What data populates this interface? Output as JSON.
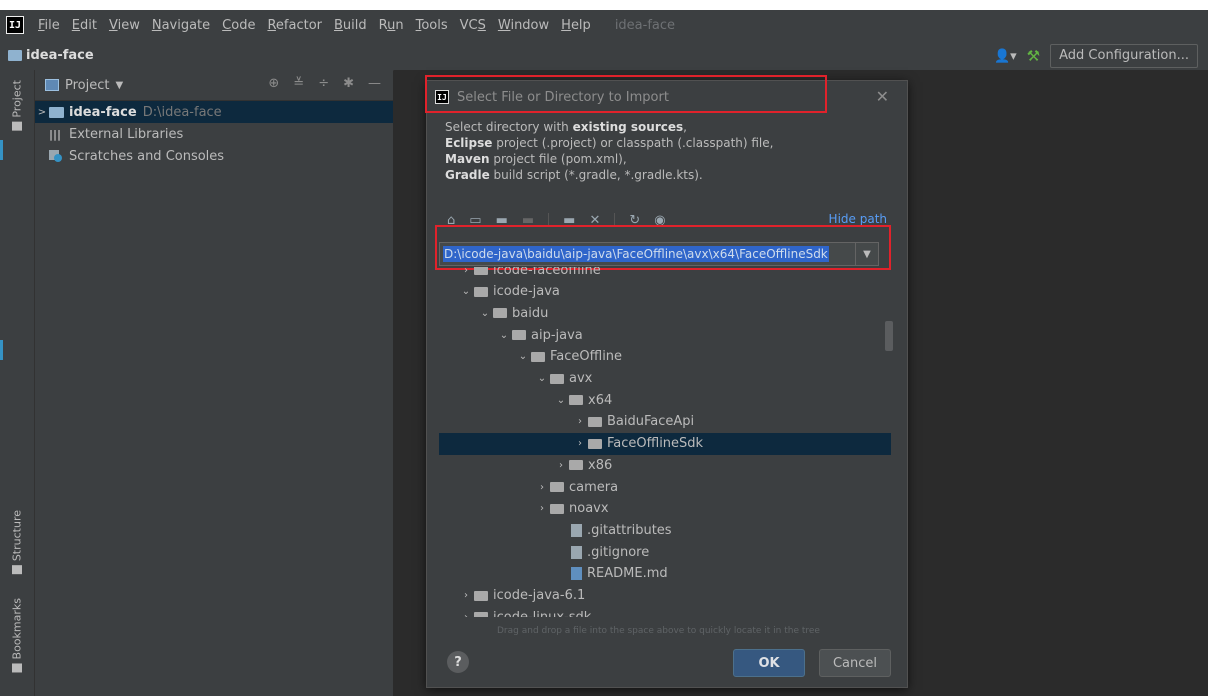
{
  "window": {
    "project_name": "idea-face"
  },
  "menu": [
    "File",
    "Edit",
    "View",
    "Navigate",
    "Code",
    "Refactor",
    "Build",
    "Run",
    "Tools",
    "VCS",
    "Window",
    "Help"
  ],
  "menu_mnemonic": [
    "F",
    "E",
    "V",
    "N",
    "C",
    "R",
    "B",
    "u",
    "T",
    "S",
    "W",
    "H"
  ],
  "navbar": {
    "title": "idea-face",
    "add_config": "Add Configuration..."
  },
  "side_tabs": {
    "project": "Project",
    "structure": "Structure",
    "bookmarks": "Bookmarks"
  },
  "project_panel": {
    "title": "Project",
    "tree": [
      {
        "label": "idea-face",
        "path": "D:\\idea-face",
        "selected": true
      },
      {
        "label": "External Libraries"
      },
      {
        "label": "Scratches and Consoles"
      }
    ]
  },
  "dialog": {
    "title": "Select File or Directory to Import",
    "desc": {
      "line1_pre": "Select directory with ",
      "line1_bold": "existing sources",
      "line1_post": ",",
      "line2_bold": "Eclipse",
      "line2_post": " project (.project) or classpath (.classpath) file,",
      "line3_bold": "Maven",
      "line3_post": " project file (pom.xml),",
      "line4_bold": "Gradle",
      "line4_post": " build script (*.gradle, *.gradle.kts)."
    },
    "hide_path": "Hide path",
    "path_value": "D:\\icode-java\\baidu\\aip-java\\FaceOffline\\avx\\x64\\FaceOfflineSdk",
    "tree": [
      {
        "label": "icode-faceoffline",
        "arrow": ">",
        "type": "folder"
      },
      {
        "label": "icode-java",
        "arrow": "v",
        "type": "folder"
      },
      {
        "label": "baidu",
        "arrow": "v",
        "type": "folder"
      },
      {
        "label": "aip-java",
        "arrow": "v",
        "type": "folder"
      },
      {
        "label": "FaceOffline",
        "arrow": "v",
        "type": "folder"
      },
      {
        "label": "avx",
        "arrow": "v",
        "type": "folder"
      },
      {
        "label": "x64",
        "arrow": "v",
        "type": "folder"
      },
      {
        "label": "BaiduFaceApi",
        "arrow": ">",
        "type": "folder"
      },
      {
        "label": "FaceOfflineSdk",
        "arrow": ">",
        "type": "folder",
        "selected": true
      },
      {
        "label": "x86",
        "arrow": ">",
        "type": "folder"
      },
      {
        "label": "camera",
        "arrow": ">",
        "type": "folder"
      },
      {
        "label": "noavx",
        "arrow": ">",
        "type": "folder"
      },
      {
        "label": ".gitattributes",
        "arrow": "",
        "type": "file"
      },
      {
        "label": ".gitignore",
        "arrow": "",
        "type": "file"
      },
      {
        "label": "README.md",
        "arrow": "",
        "type": "md"
      },
      {
        "label": "icode-java-6.1",
        "arrow": ">",
        "type": "folder"
      },
      {
        "label": "icode-linux-sdk",
        "arrow": ">",
        "type": "folder"
      }
    ],
    "hint": "Drag and drop a file into the space above to quickly locate it in the tree",
    "ok": "OK",
    "cancel": "Cancel",
    "help": "?"
  },
  "colors": {
    "highlight_box": "#e1222b",
    "selection": "#0d293e",
    "link": "#589df6"
  }
}
